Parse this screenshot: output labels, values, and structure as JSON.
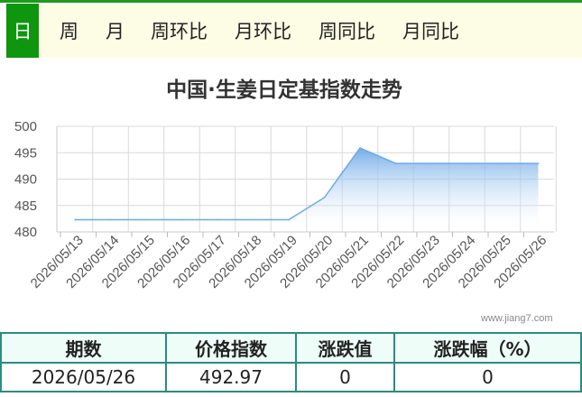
{
  "tabs": [
    {
      "label": "日",
      "active": true
    },
    {
      "label": "周",
      "active": false
    },
    {
      "label": "月",
      "active": false
    },
    {
      "label": "周环比",
      "active": false
    },
    {
      "label": "月环比",
      "active": false
    },
    {
      "label": "周同比",
      "active": false
    },
    {
      "label": "月同比",
      "active": false
    }
  ],
  "watermark": "www.jiang7.com",
  "chart_data": {
    "type": "area",
    "title": "中国·生姜日定基指数走势",
    "x": [
      "2026/05/13",
      "2026/05/14",
      "2026/05/15",
      "2026/05/16",
      "2026/05/17",
      "2026/05/18",
      "2026/05/19",
      "2026/05/20",
      "2026/05/21",
      "2026/05/22",
      "2026/05/23",
      "2026/05/24",
      "2026/05/25",
      "2026/05/26"
    ],
    "values": [
      482.3,
      482.3,
      482.3,
      482.3,
      482.3,
      482.3,
      482.3,
      486.5,
      495.9,
      492.97,
      492.97,
      492.97,
      492.97,
      492.97
    ],
    "yticks": [
      480,
      485,
      490,
      495,
      500
    ],
    "ylim": [
      480,
      500
    ],
    "grid": true,
    "colors": {
      "line": "#6aaae6",
      "fill_top": "#6ea8e8",
      "fill_bottom": "#ffffff"
    }
  },
  "table": {
    "headers": [
      "期数",
      "价格指数",
      "涨跌值",
      "涨跌幅（%）"
    ],
    "row": [
      "2026/05/26",
      "492.97",
      "0",
      "0"
    ]
  }
}
